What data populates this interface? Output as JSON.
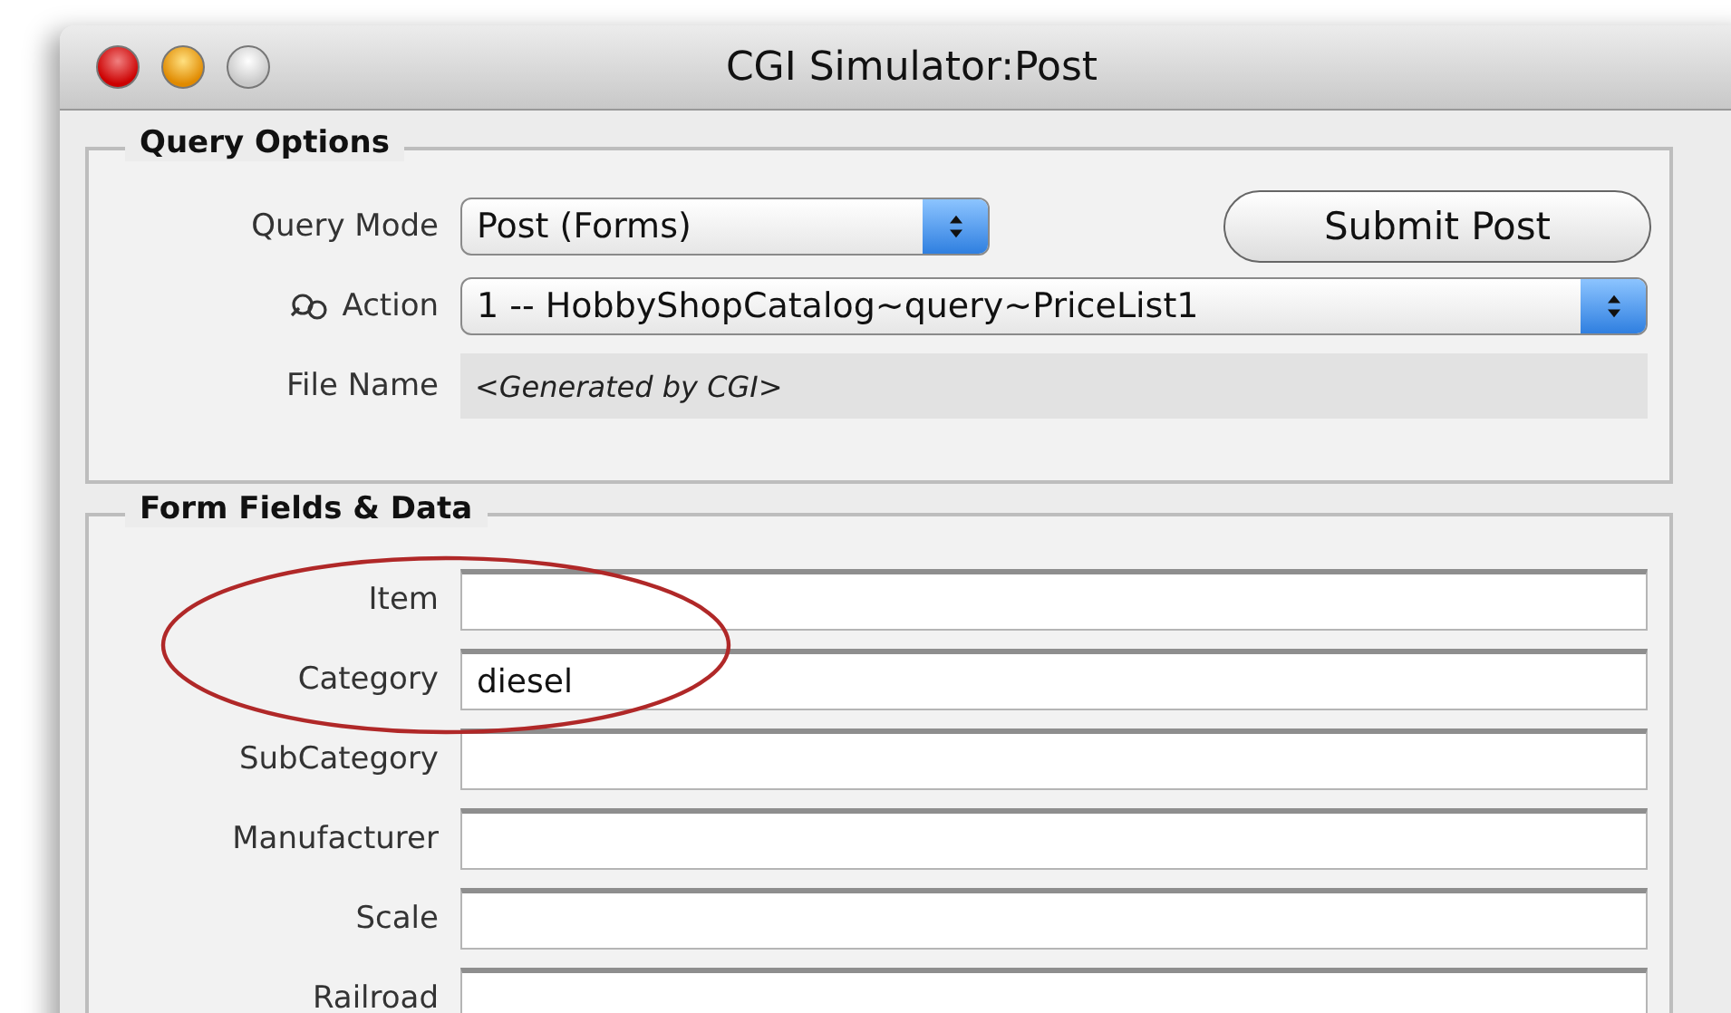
{
  "window": {
    "title": "CGI Simulator:Post"
  },
  "query_options": {
    "title": "Query Options",
    "query_mode": {
      "label": "Query Mode",
      "value": "Post (Forms)"
    },
    "submit_button": "Submit Post",
    "action": {
      "label": "Action",
      "value": "1 -- HobbyShopCatalog~query~PriceList1"
    },
    "file_name": {
      "label": "File Name",
      "value": "<Generated by CGI>"
    }
  },
  "form_fields": {
    "title": "Form Fields & Data",
    "fields": [
      {
        "label": "Item"
      },
      {
        "label": "Category",
        "value": "diesel"
      },
      {
        "label": "SubCategory"
      },
      {
        "label": "Manufacturer"
      },
      {
        "label": "Scale"
      },
      {
        "label": "Railroad"
      }
    ]
  }
}
